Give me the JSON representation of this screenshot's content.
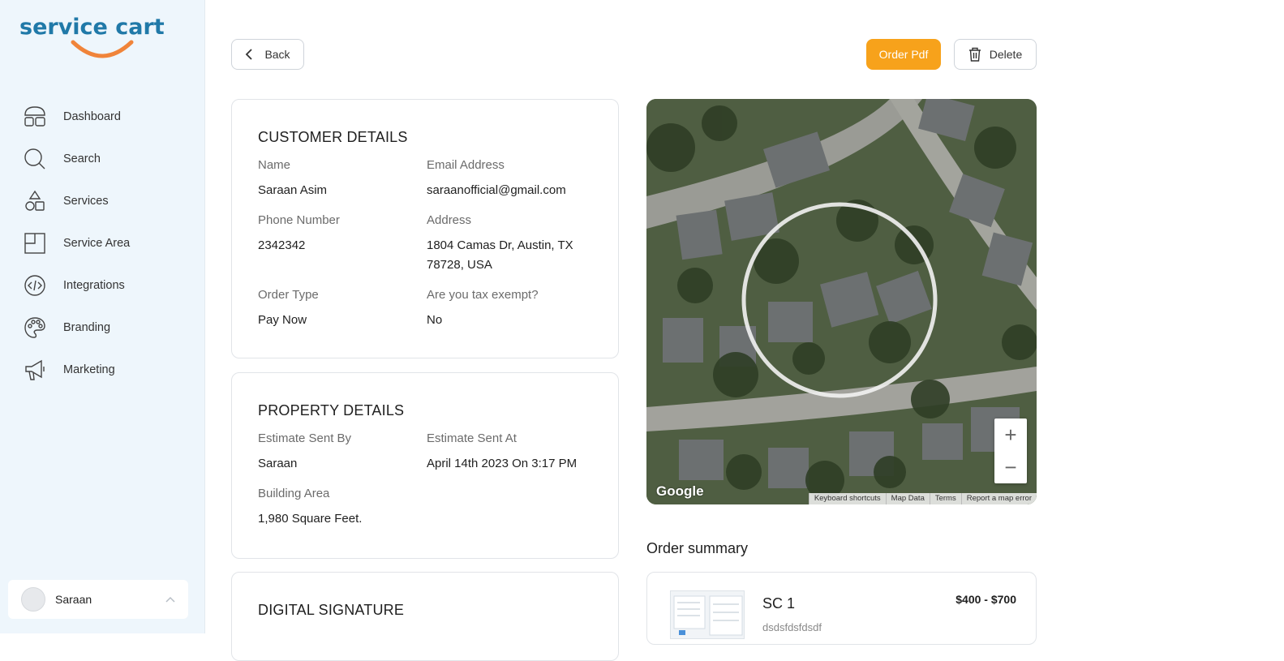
{
  "brand": {
    "name": "service cart",
    "color": "#2079a8",
    "accent": "#f0843a"
  },
  "sidebar": {
    "items": [
      {
        "label": "Dashboard",
        "icon": "dashboard-icon"
      },
      {
        "label": "Search",
        "icon": "search-icon"
      },
      {
        "label": "Services",
        "icon": "shapes-icon"
      },
      {
        "label": "Service Area",
        "icon": "area-icon"
      },
      {
        "label": "Integrations",
        "icon": "code-icon"
      },
      {
        "label": "Branding",
        "icon": "palette-icon"
      },
      {
        "label": "Marketing",
        "icon": "megaphone-icon"
      }
    ],
    "user": {
      "name": "Saraan"
    }
  },
  "toolbar": {
    "back_label": "Back",
    "pdf_label": "Order Pdf",
    "delete_label": "Delete",
    "pdf_color": "#f7a21b"
  },
  "customer": {
    "title": "CUSTOMER DETAILS",
    "name_label": "Name",
    "name": "Saraan Asim",
    "email_label": "Email Address",
    "email": "saraanofficial@gmail.com",
    "phone_label": "Phone Number",
    "phone": "2342342",
    "address_label": "Address",
    "address": "1804 Camas Dr, Austin, TX 78728, USA",
    "order_type_label": "Order Type",
    "order_type": "Pay Now",
    "tax_label": "Are you tax exempt?",
    "tax": "No"
  },
  "property": {
    "title": "PROPERTY DETAILS",
    "sent_by_label": "Estimate Sent By",
    "sent_by": "Saraan",
    "sent_at_label": "Estimate Sent At",
    "sent_at": "April 14th 2023 On 3:17 PM",
    "area_label": "Building Area",
    "area": "1,980 Square Feet."
  },
  "signature": {
    "title": "DIGITAL SIGNATURE"
  },
  "map": {
    "logo": "Google",
    "footer": [
      "Keyboard shortcuts",
      "Map Data",
      "Terms",
      "Report a map error"
    ]
  },
  "order_summary": {
    "title": "Order summary",
    "items": [
      {
        "name": "SC 1",
        "desc": "dsdsfdsfdsdf",
        "price": "$400 - $700"
      }
    ]
  }
}
